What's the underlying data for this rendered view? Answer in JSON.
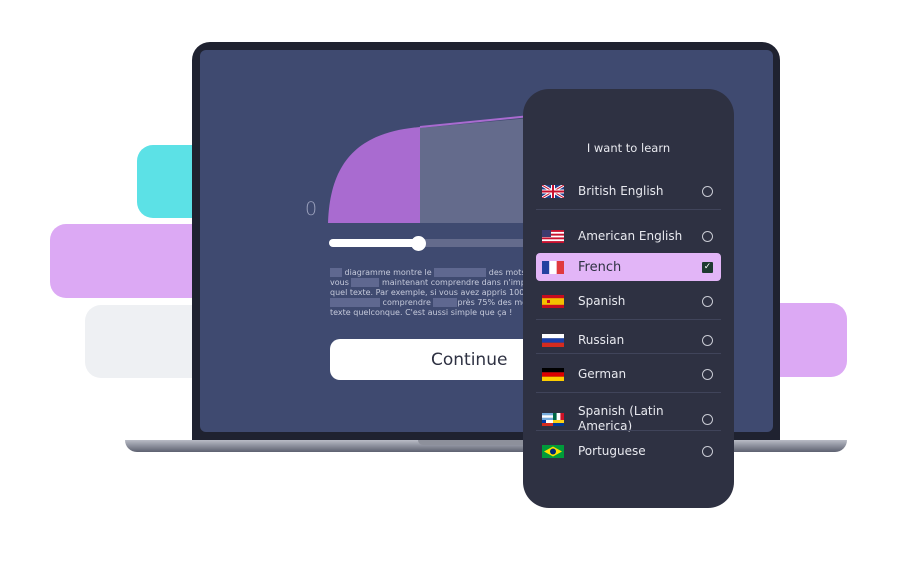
{
  "colors": {
    "accent": "#e2b5f7",
    "purple": "#a96bd0",
    "cyan": "#5ce1e6",
    "screen": "#3f4a70",
    "phone": "#2e3142"
  },
  "chart": {
    "zero_label": "0",
    "slider_value_percent": 47
  },
  "paragraph": {
    "parts": [
      "diagramme montre le",
      "des mots c",
      "vous",
      "maintenant comprendre dans n'impo",
      "quel texte. Par exemple, si vous avez appris 1000",
      "comprendre",
      "près 75% des mo",
      "texte quelconque. C'est aussi simple que ça !"
    ]
  },
  "continue_label": "Continue",
  "picker": {
    "title": "I want to learn",
    "languages": [
      {
        "label": "British English",
        "flag": "uk-flag-icon",
        "selected": false
      },
      {
        "label": "American English",
        "flag": "us-flag-icon",
        "selected": false
      },
      {
        "label": "French",
        "flag": "france-flag-icon",
        "selected": true
      },
      {
        "label": "Spanish",
        "flag": "spain-flag-icon",
        "selected": false
      },
      {
        "label": "Russian",
        "flag": "russia-flag-icon",
        "selected": false
      },
      {
        "label": "German",
        "flag": "germany-flag-icon",
        "selected": false
      },
      {
        "label": "Spanish (Latin America)",
        "flag": "latin-america-flags-icon",
        "selected": false
      },
      {
        "label": "Portuguese",
        "flag": "brazil-flag-icon",
        "selected": false
      }
    ]
  }
}
